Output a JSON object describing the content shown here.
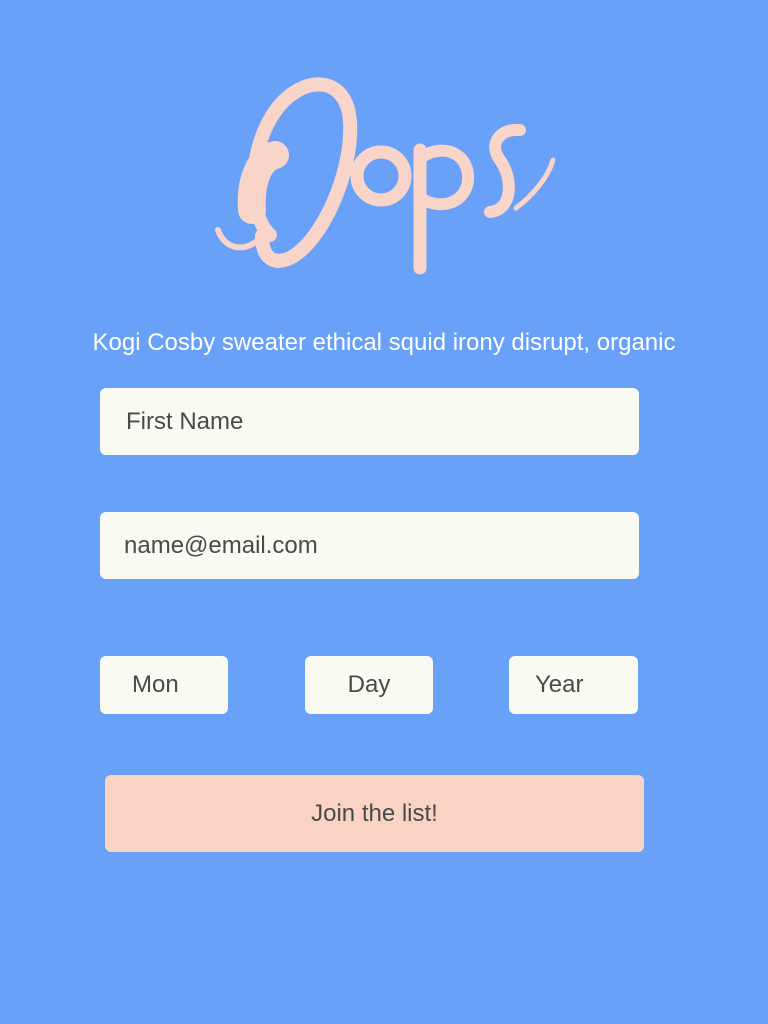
{
  "logo": {
    "text": "Oops",
    "color": "#f9d4c8"
  },
  "tagline": "Kogi Cosby sweater ethical squid irony disrupt, organic",
  "form": {
    "first_name_placeholder": "First Name",
    "email_placeholder": "name@email.com",
    "month_placeholder": "Mon",
    "day_placeholder": "Day",
    "year_placeholder": "Year",
    "submit_label": "Join the list!"
  },
  "colors": {
    "background": "#6aa1f8",
    "field": "#f9faf2",
    "button": "#f9d4c4",
    "text": "#4a4a4a"
  }
}
